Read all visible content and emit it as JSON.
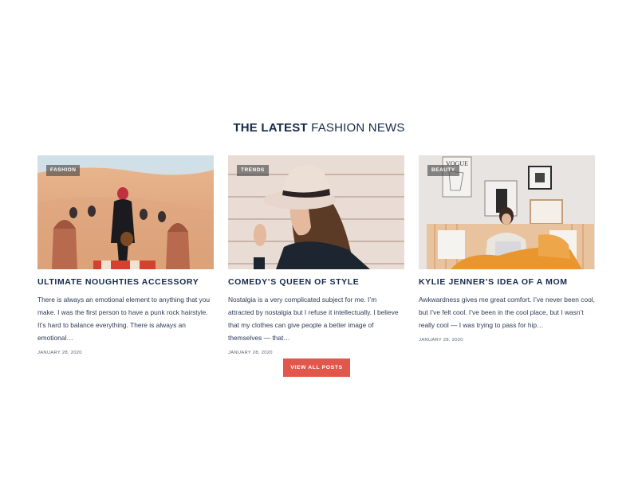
{
  "section": {
    "title_strong": "THE LATEST",
    "title_light": "FASHION NEWS"
  },
  "posts": [
    {
      "category": "FASHION",
      "title": "ULTIMATE NOUGHTIES ACCESSORY",
      "excerpt": "There is always an emotional element to anything that you make. I was the first person to have a punk rock hairstyle. It’s hard to balance everything.  There is always an emotional…",
      "date": "JANUARY 28, 2020"
    },
    {
      "category": "TRENDS",
      "title": "COMEDY’S QUEEN OF STYLE",
      "excerpt": "Nostalgia is a very complicated subject for me. I’m attracted by nostalgia but I refuse it intellectually. I believe that my clothes can give people a better image of themselves — that…",
      "date": "JANUARY 28, 2020"
    },
    {
      "category": "BEAUTY",
      "title": "KYLIE JENNER’S IDEA OF A MOM",
      "excerpt": "Awkwardness gives me great comfort. I’ve never been cool, but I’ve felt cool. I’ve been in the cool place, but I wasn’t really cool — I was trying to pass for hip…",
      "date": "JANUARY 28, 2020",
      "poster_text": "VOGUE"
    }
  ],
  "cta": {
    "label": "VIEW ALL POSTS"
  },
  "colors": {
    "accent": "#e2574c",
    "heading": "#14284b"
  }
}
